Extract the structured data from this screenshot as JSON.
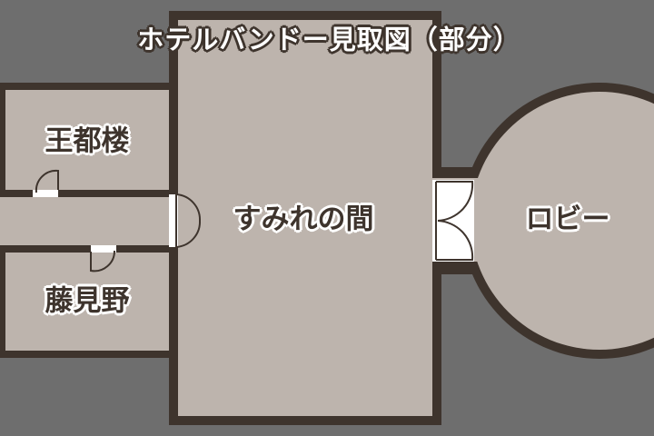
{
  "title": "ホテルバンドー見取図（部分）",
  "rooms": {
    "oumirou": "王都楼",
    "fujimino": "藤見野",
    "sumire": "すみれの間",
    "lobby": "ロビー"
  },
  "colors": {
    "background": "#6e6e6e",
    "wall": "#3e342d",
    "floor": "#bdb4ad",
    "door": "#ffffff"
  }
}
